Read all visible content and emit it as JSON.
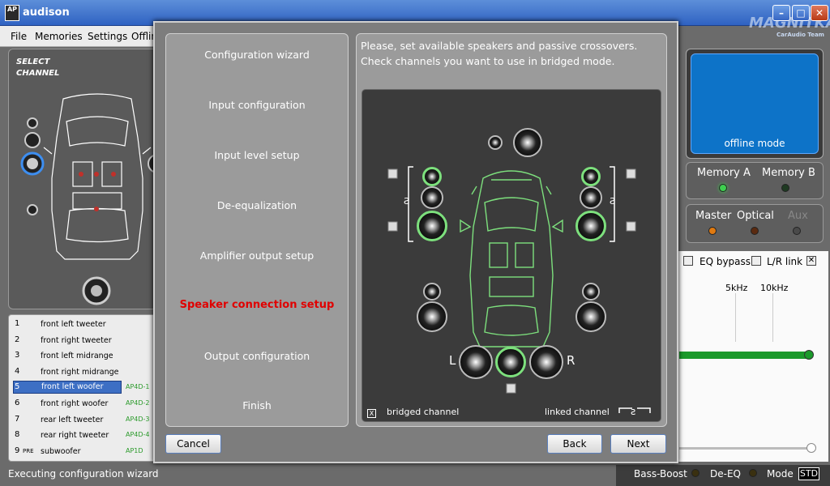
{
  "app": {
    "title": "audison",
    "logo": "AP",
    "watermark": "MAGNITKA",
    "watermark_sub": "CarAudio Team"
  },
  "menu": [
    "File",
    "Memories",
    "Settings",
    "Offlin"
  ],
  "left": {
    "select_channel": [
      "SELECT",
      "CHANNEL"
    ],
    "channels": [
      {
        "num": "1",
        "name": "front left tweeter",
        "code": ""
      },
      {
        "num": "2",
        "name": "front right tweeter",
        "code": ""
      },
      {
        "num": "3",
        "name": "front left midrange",
        "code": ""
      },
      {
        "num": "4",
        "name": "front right midrange",
        "code": ""
      },
      {
        "num": "5",
        "name": "front left woofer",
        "code": "AP4D-1"
      },
      {
        "num": "6",
        "name": "front right woofer",
        "code": "AP4D-2"
      },
      {
        "num": "7",
        "name": "rear left tweeter",
        "code": "AP4D-3"
      },
      {
        "num": "8",
        "name": "rear right tweeter",
        "code": "AP4D-4"
      },
      {
        "num": "9",
        "pre": "PRE",
        "name": "subwoofer",
        "code": "AP1D"
      }
    ],
    "status": "Executing configuration wizard"
  },
  "right": {
    "offline": "offline mode",
    "memory_a": "Memory A",
    "memory_b": "Memory B",
    "master": "Master",
    "optical": "Optical",
    "aux": "Aux",
    "eq_bypass": "EQ bypass",
    "lr_link": "L/R link",
    "freq1": "5kHz",
    "freq2": "10kHz",
    "bass_boost": "Bass-Boost",
    "de_eq": "De-EQ",
    "mode": "Mode",
    "std": "STD",
    "colors": {
      "led_green": "#3ecf4f",
      "led_orange": "#e07a10",
      "led_off": "#4a3a20",
      "eq_green": "#1b9a2b"
    }
  },
  "dialog": {
    "steps": [
      "Configuration wizard",
      "Input configuration",
      "Input level setup",
      "De-equalization",
      "Amplifier output setup",
      "Speaker connection setup",
      "Output configuration",
      "Finish"
    ],
    "active_step": "Speaker connection setup",
    "instruction": "Please, set available speakers and passive crossovers. Check channels you want to use in bridged mode.",
    "left_label": "L",
    "right_label": "R",
    "bridged": "bridged channel",
    "bridged_mark": "X",
    "linked": "linked channel",
    "cancel": "Cancel",
    "back": "Back",
    "next": "Next",
    "speaker_on_color": "#7de07d"
  }
}
